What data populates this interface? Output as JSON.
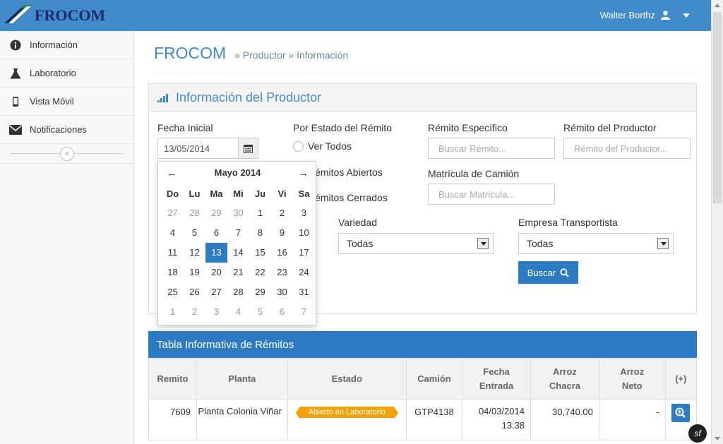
{
  "header": {
    "brand": "FROCOM",
    "user_name": "Walter Borthz",
    "accent": "#428bca"
  },
  "sidebar": {
    "items": [
      {
        "label": "Información",
        "icon": "info-icon"
      },
      {
        "label": "Laboratorio",
        "icon": "flask-icon"
      },
      {
        "label": "Vista Móvil",
        "icon": "mobile-icon"
      },
      {
        "label": "Notificaciones",
        "icon": "envelope-icon"
      }
    ],
    "collapse_icon": "double-chevron-left-icon"
  },
  "page": {
    "title": "FROCOM",
    "breadcrumb": [
      "Productor",
      "Información"
    ]
  },
  "panel": {
    "title": "Información del Productor",
    "fecha_inicial_label": "Fecha Inicial",
    "fecha_inicial_value": "13/05/2014",
    "estado_label": "Por Estado del Rémito",
    "estado_options": [
      "Ver Todos",
      "Rémitos Abiertos",
      "Rémitos Cerrados"
    ],
    "remito_especifico_label": "Rémito Específico",
    "remito_especifico_placeholder": "Buscar Rémito...",
    "remito_productor_label": "Rémito del Productor",
    "remito_productor_placeholder": "Rémito del Productor...",
    "matricula_label": "Matrícula de Camión",
    "matricula_placeholder": "Buscar Matrícula...",
    "variedad_label": "Variedad",
    "variedad_value": "Todas",
    "empresa_label": "Empresa Transportista",
    "empresa_value": "Todas",
    "buscar_label": "Buscar"
  },
  "calendar": {
    "month_label": "Mayo 2014",
    "days_of_week": [
      "Do",
      "Lu",
      "Ma",
      "Mi",
      "Ju",
      "Vi",
      "Sa"
    ],
    "weeks": [
      [
        {
          "d": "27",
          "o": true
        },
        {
          "d": "28",
          "o": true
        },
        {
          "d": "29",
          "o": true
        },
        {
          "d": "30",
          "o": true
        },
        {
          "d": "1"
        },
        {
          "d": "2"
        },
        {
          "d": "3"
        }
      ],
      [
        {
          "d": "4"
        },
        {
          "d": "5"
        },
        {
          "d": "6"
        },
        {
          "d": "7"
        },
        {
          "d": "8"
        },
        {
          "d": "9"
        },
        {
          "d": "10"
        }
      ],
      [
        {
          "d": "11"
        },
        {
          "d": "12"
        },
        {
          "d": "13",
          "s": true
        },
        {
          "d": "14"
        },
        {
          "d": "15"
        },
        {
          "d": "16"
        },
        {
          "d": "17"
        }
      ],
      [
        {
          "d": "18"
        },
        {
          "d": "19"
        },
        {
          "d": "20"
        },
        {
          "d": "21"
        },
        {
          "d": "22"
        },
        {
          "d": "23"
        },
        {
          "d": "24"
        }
      ],
      [
        {
          "d": "25"
        },
        {
          "d": "26"
        },
        {
          "d": "27"
        },
        {
          "d": "28"
        },
        {
          "d": "29"
        },
        {
          "d": "30"
        },
        {
          "d": "31"
        }
      ],
      [
        {
          "d": "1",
          "o": true
        },
        {
          "d": "2",
          "o": true
        },
        {
          "d": "3",
          "o": true
        },
        {
          "d": "4",
          "o": true
        },
        {
          "d": "5",
          "o": true
        },
        {
          "d": "6",
          "o": true
        },
        {
          "d": "7",
          "o": true
        }
      ]
    ]
  },
  "table": {
    "title": "Tabla Informativa de Rémitos",
    "columns": [
      "Remito",
      "Planta",
      "Estado",
      "Camión",
      "Fecha Entrada",
      "Arroz Chacra",
      "Arroz Neto",
      "(+)"
    ],
    "rows": [
      {
        "remito": "7609",
        "planta": "Planta Colonia Viñar",
        "estado": "Abierto en Laboratorio",
        "camion": "GTP4138",
        "fecha_entrada": "04/03/2014 13:38",
        "arroz_chacra": "30,740.00",
        "arroz_neto": "-"
      }
    ]
  },
  "status_badge_color": "#f0a30a"
}
